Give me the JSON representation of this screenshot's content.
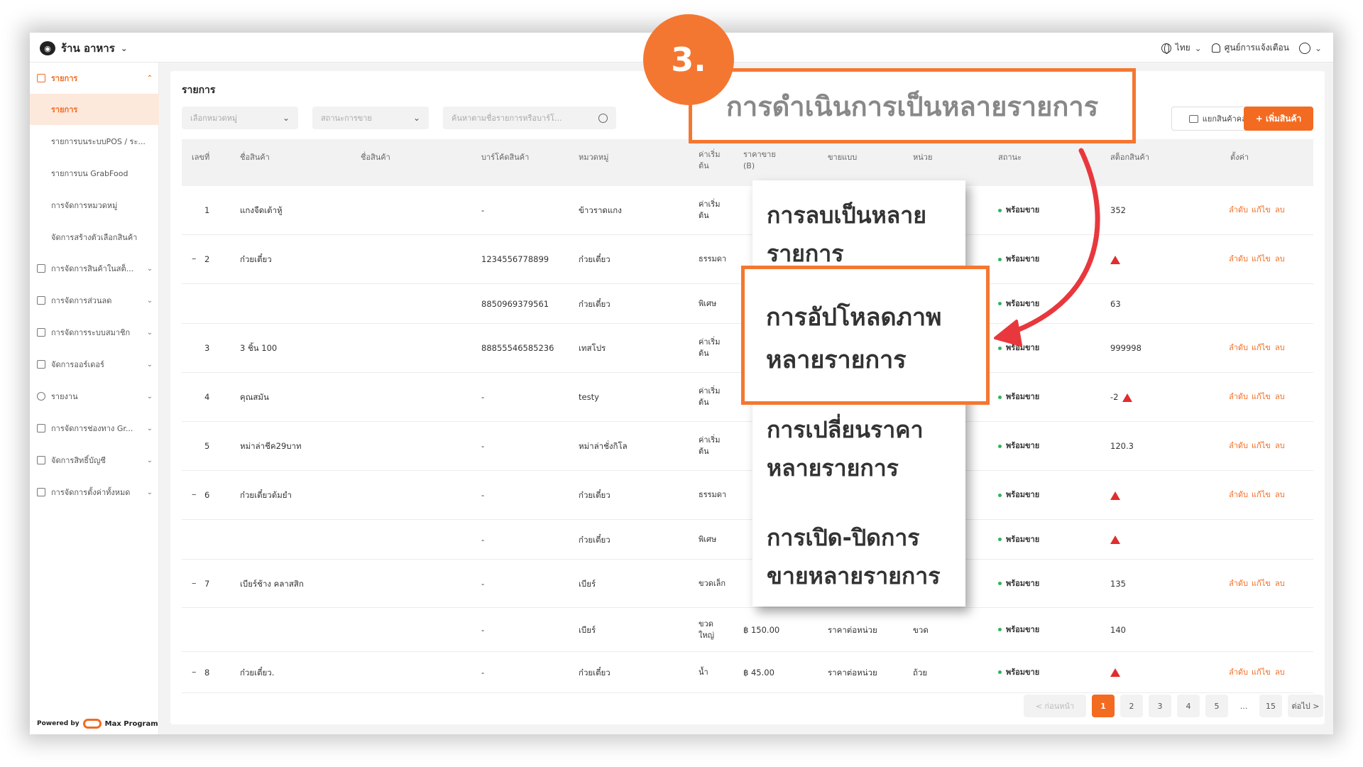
{
  "topbar": {
    "shop_name": "ร้าน อาหาร",
    "language": "ไทย",
    "notifications": "ศูนย์การแจ้งเตือน"
  },
  "sidebar": {
    "head": "รายการ",
    "subs": [
      "รายการ",
      "รายการบนระบบPOS / ระ...",
      "รายการบน GrabFood",
      "การจัดการหมวดหมู่",
      "จัดการสร้างตัวเลือกสินค้า"
    ],
    "items": [
      "การจัดการสินค้าในสต็...",
      "การจัดการส่วนลด",
      "การจัดการระบบสมาชิก",
      "จัดการออร์เดอร์",
      "รายงาน",
      "การจัดการช่องทาง Gr...",
      "จัดการสิทธิ์บัญชี",
      "การจัดการตั้งค่าทั้งหมด"
    ],
    "powered_by": "Powered by",
    "brand": "Max Program"
  },
  "main": {
    "title": "รายการ",
    "filter_category": "เลือกหมวดหมู่",
    "filter_status": "สถานะการขาย",
    "search_placeholder": "ค้นหาตามชื่อรายการหรือบาร์โ...",
    "btn_warehouse": "แยกสินค้าคลัง",
    "btn_add": "+ เพิ่มสินค้า"
  },
  "table": {
    "headers": {
      "no": "เลขที่",
      "name": "ชื่อสินค้า",
      "name2": "ชื่อสินค้า",
      "barcode": "บาร์โค้ดสินค้า",
      "category": "หมวดหมู่",
      "start": "ค่าเริ่มต้น",
      "price": "ราคาขาย (B)",
      "sell_type": "ขายแบบ",
      "unit": "หน่วย",
      "status": "สถานะ",
      "stock": "สต็อกสินค้า",
      "settings": "ตั้งค่า"
    },
    "rows": [
      {
        "no": "1",
        "name": "แกงจืดเต้าหู้",
        "barcode": "-",
        "category": "ข้าวราดแกง",
        "start": "ค่าเริ่มต้น",
        "price": "",
        "sell_type": "",
        "unit": "",
        "status": "พร้อมขาย",
        "stock": "352",
        "actions": true
      },
      {
        "no": "2",
        "name": "ก๋วยเตี๋ยว",
        "barcode": "1234556778899",
        "category": "ก๋วยเตี๋ยว",
        "start": "ธรรมดา",
        "price": "",
        "sell_type": "",
        "unit": "",
        "status": "พร้อมขาย",
        "stock": "",
        "actions": true
      },
      {
        "no": "",
        "name": "",
        "barcode": "8850969379561",
        "category": "ก๋วยเตี๋ยว",
        "start": "พิเศษ",
        "price": "",
        "sell_type": "",
        "unit": "",
        "status": "พร้อมขาย",
        "stock": "63",
        "actions": false
      },
      {
        "no": "3",
        "name": "3 ชิ้น 100",
        "barcode": "88855546585236",
        "category": "เทสโปร",
        "start": "ค่าเริ่มต้น",
        "price": "",
        "sell_type": "",
        "unit": "",
        "status": "พร้อมขาย",
        "stock": "999998",
        "actions": true
      },
      {
        "no": "4",
        "name": "คุณสมัน",
        "barcode": "-",
        "category": "testy",
        "start": "ค่าเริ่มต้น",
        "price": "",
        "sell_type": "",
        "unit": "",
        "status": "พร้อมขาย",
        "stock": "-2",
        "actions": true
      },
      {
        "no": "5",
        "name": "หม่าล่าชีค29บาท",
        "barcode": "-",
        "category": "หม่าล่าชั่งกิโล",
        "start": "ค่าเริ่มต้น",
        "price": "",
        "sell_type": "",
        "unit": "",
        "status": "พร้อมขาย",
        "stock": "120.3",
        "actions": true
      },
      {
        "no": "6",
        "name": "ก๋วยเตี๋ยวต้มยำ",
        "barcode": "-",
        "category": "ก๋วยเตี๋ยว",
        "start": "ธรรมดา",
        "price": "",
        "sell_type": "",
        "unit": "",
        "status": "พร้อมขาย",
        "stock": "",
        "actions": true
      },
      {
        "no": "",
        "name": "",
        "barcode": "-",
        "category": "ก๋วยเตี๋ยว",
        "start": "พิเศษ",
        "price": "",
        "sell_type": "",
        "unit": "",
        "status": "พร้อมขาย",
        "stock": "",
        "actions": false
      },
      {
        "no": "7",
        "name": "เบียร์ช้าง คลาสสิก",
        "barcode": "-",
        "category": "เบียร์",
        "start": "ขวดเล็ก",
        "price": "",
        "sell_type": "",
        "unit": "",
        "status": "พร้อมขาย",
        "stock": "135",
        "actions": true
      },
      {
        "no": "",
        "name": "",
        "barcode": "-",
        "category": "เบียร์",
        "start": "ขวดใหญ่",
        "price": "฿ 150.00",
        "sell_type": "ราคาต่อหน่วย",
        "unit": "ขวด",
        "status": "พร้อมขาย",
        "stock": "140",
        "actions": false
      },
      {
        "no": "8",
        "name": "ก๋วยเตี๋ยว.",
        "barcode": "-",
        "category": "ก๋วยเตี๋ยว",
        "start": "น้ำ",
        "price": "฿ 45.00",
        "sell_type": "ราคาต่อหน่วย",
        "unit": "ถ้วย",
        "status": "พร้อมขาย",
        "stock": "",
        "actions": true
      }
    ],
    "action_order": "ลำดับ",
    "action_edit": "แก้ไข",
    "action_delete": "ลบ"
  },
  "pagination": {
    "prev": "< ก่อนหน้า",
    "pages": [
      "1",
      "2",
      "3",
      "4",
      "5"
    ],
    "ellipsis": "...",
    "last": "15",
    "next": "ต่อไป >"
  },
  "overlay": {
    "step": "3.",
    "callout": "การดำเนินการเป็นหลายรายการ",
    "menu": [
      "การลบเป็นหลาย",
      "รายการ",
      "การเปลี่ยนราคา",
      "หลายรายการ",
      "การเปิด-ปิดการ",
      "ขายหลายรายการ"
    ],
    "highlight": [
      "การอัปโหลดภาพ",
      "หลายรายการ"
    ]
  },
  "colors": {
    "accent": "#f26b21",
    "overlay_accent": "#f47731",
    "arrow": "#e8383d",
    "status_ok": "#2fb45a",
    "warning": "#e02d2d"
  }
}
